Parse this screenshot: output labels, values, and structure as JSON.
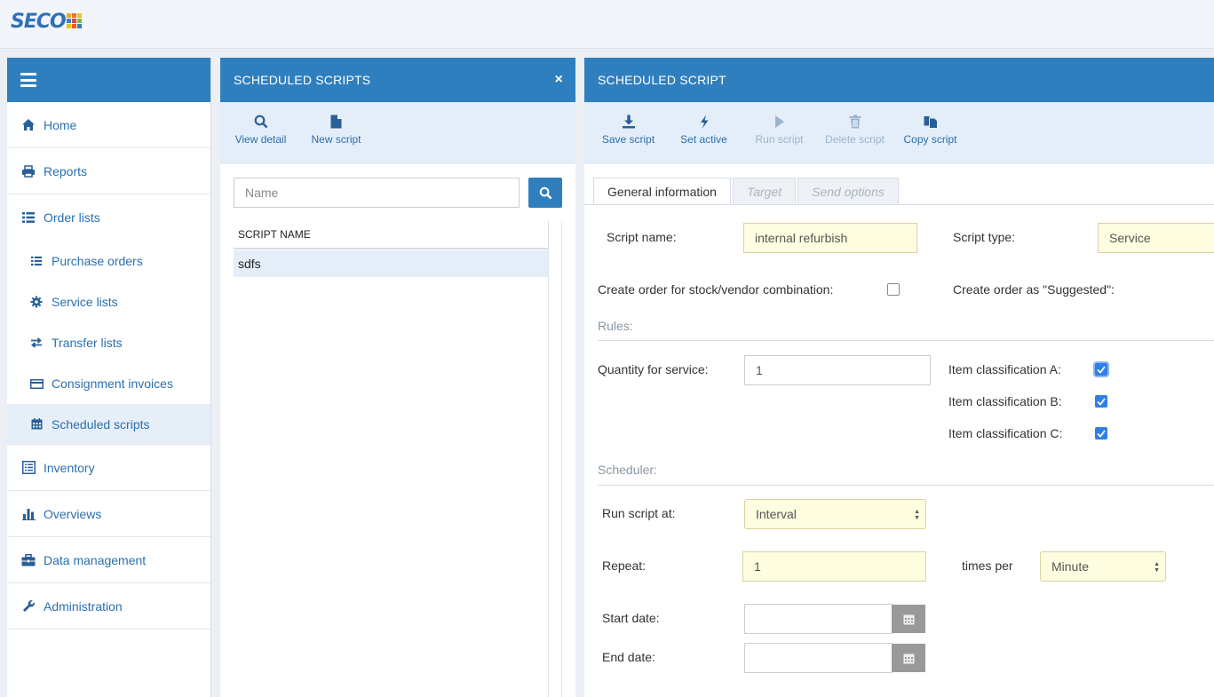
{
  "brand": {
    "logo_text": "SECO",
    "square_colors": [
      "#f5a623",
      "#e8762a",
      "#f0c419",
      "#3a86c8",
      "#e14b3b",
      "#7fbf3f",
      "#f2c20f",
      "#e65c2e",
      "#2f7fbf"
    ]
  },
  "sidebar": {
    "items": [
      {
        "label": "Home",
        "icon": "home-icon"
      },
      {
        "label": "Reports",
        "icon": "printer-icon"
      },
      {
        "label": "Order lists",
        "icon": "list-icon"
      },
      {
        "label": "Inventory",
        "icon": "inventory-icon"
      },
      {
        "label": "Overviews",
        "icon": "bar-chart-icon"
      },
      {
        "label": "Data management",
        "icon": "briefcase-icon"
      },
      {
        "label": "Administration",
        "icon": "wrench-icon"
      }
    ],
    "subitems": [
      {
        "label": "Purchase orders",
        "icon": "list-icon"
      },
      {
        "label": "Service lists",
        "icon": "gear-icon"
      },
      {
        "label": "Transfer lists",
        "icon": "transfer-icon"
      },
      {
        "label": "Consignment invoices",
        "icon": "card-icon"
      },
      {
        "label": "Scheduled scripts",
        "icon": "calendar-icon"
      }
    ]
  },
  "list_panel": {
    "title": "SCHEDULED SCRIPTS",
    "close": "×",
    "toolbar": {
      "view_detail": "View detail",
      "new_script": "New script"
    },
    "search_placeholder": "Name",
    "column_header": "SCRIPT NAME",
    "rows": [
      "sdfs"
    ]
  },
  "detail_panel": {
    "title": "SCHEDULED SCRIPT",
    "toolbar": {
      "save": "Save script",
      "set_active": "Set active",
      "run": "Run script",
      "delete": "Delete script",
      "copy": "Copy script"
    },
    "tabs": [
      "General information",
      "Target",
      "Send options"
    ],
    "script_name_label": "Script name:",
    "script_name_value": "internal refurbish",
    "script_type_label": "Script type:",
    "script_type_value": "Service",
    "create_order_label": "Create order for stock/vendor combination:",
    "create_suggested_label": "Create order as \"Suggested\":",
    "rules_label": "Rules:",
    "quantity_label": "Quantity for service:",
    "quantity_value": "1",
    "class_a_label": "Item classification A:",
    "class_b_label": "Item classification B:",
    "class_c_label": "Item classification C:",
    "create_order_checked": false,
    "class_a_checked": true,
    "class_b_checked": true,
    "class_c_checked": true,
    "scheduler_label": "Scheduler:",
    "run_at_label": "Run script at:",
    "run_at_value": "Interval",
    "repeat_label": "Repeat:",
    "repeat_value": "1",
    "times_per_label": "times per",
    "times_per_value": "Minute",
    "start_date_label": "Start date:",
    "start_date_value": "",
    "end_date_label": "End date:",
    "end_date_value": ""
  }
}
